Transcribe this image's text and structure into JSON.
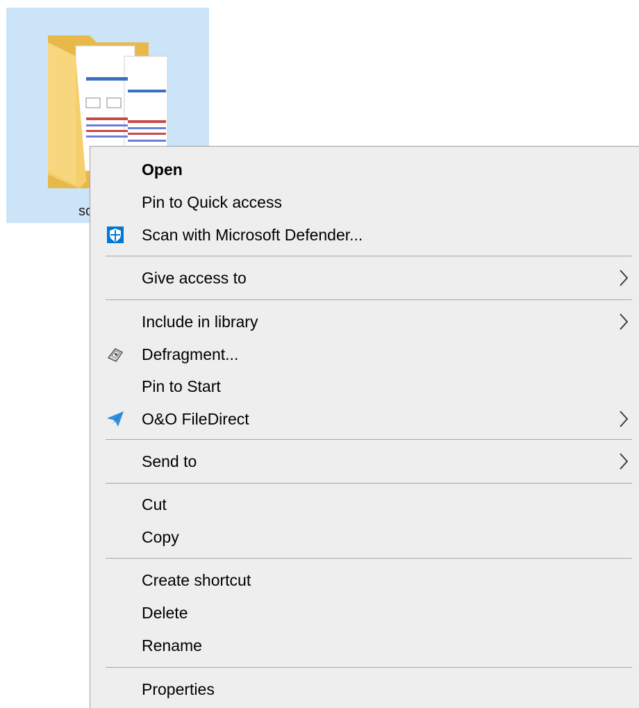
{
  "desktop": {
    "folder": {
      "label": "sc",
      "selected": true,
      "selection_color": "#cce4f7"
    }
  },
  "context_menu": {
    "background": "#eeeeee",
    "items": [
      {
        "label": "Open",
        "bold": true,
        "icon": null,
        "submenu": false
      },
      {
        "label": "Pin to Quick access",
        "bold": false,
        "icon": null,
        "submenu": false
      },
      {
        "label": "Scan with Microsoft Defender...",
        "bold": false,
        "icon": "defender-shield-icon",
        "submenu": false
      },
      {
        "label": "Give access to",
        "bold": false,
        "icon": null,
        "submenu": true
      },
      {
        "label": "Include in library",
        "bold": false,
        "icon": null,
        "submenu": true
      },
      {
        "label": "Defragment...",
        "bold": false,
        "icon": "defragment-icon",
        "submenu": false
      },
      {
        "label": "Pin to Start",
        "bold": false,
        "icon": null,
        "submenu": false
      },
      {
        "label": "O&O FileDirect",
        "bold": false,
        "icon": "paper-plane-icon",
        "submenu": true
      },
      {
        "label": "Send to",
        "bold": false,
        "icon": null,
        "submenu": true
      },
      {
        "label": "Cut",
        "bold": false,
        "icon": null,
        "submenu": false
      },
      {
        "label": "Copy",
        "bold": false,
        "icon": null,
        "submenu": false
      },
      {
        "label": "Create shortcut",
        "bold": false,
        "icon": null,
        "submenu": false
      },
      {
        "label": "Delete",
        "bold": false,
        "icon": null,
        "submenu": false
      },
      {
        "label": "Rename",
        "bold": false,
        "icon": null,
        "submenu": false
      },
      {
        "label": "Properties",
        "bold": false,
        "icon": null,
        "submenu": false
      }
    ]
  },
  "colors": {
    "defender_blue": "#0078d7",
    "filedirect_blue": "#2f8fdc",
    "separator": "#a8a8a8"
  }
}
